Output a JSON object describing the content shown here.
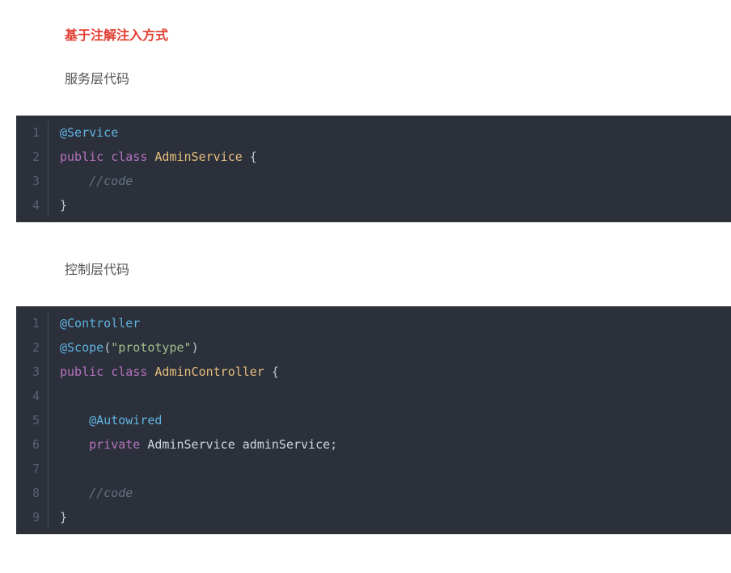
{
  "heading": "基于注解注入方式",
  "section1": {
    "title": "服务层代码",
    "lines": [
      [
        {
          "t": "@Service",
          "c": "annotation"
        }
      ],
      [
        {
          "t": "public",
          "c": "keyword"
        },
        {
          "t": " ",
          "c": "punct"
        },
        {
          "t": "class",
          "c": "keyword"
        },
        {
          "t": " ",
          "c": "punct"
        },
        {
          "t": "AdminService",
          "c": "type"
        },
        {
          "t": " {",
          "c": "punct"
        }
      ],
      [
        {
          "t": "    ",
          "c": "punct"
        },
        {
          "t": "//code",
          "c": "comment"
        }
      ],
      [
        {
          "t": "}",
          "c": "punct"
        }
      ]
    ]
  },
  "section2": {
    "title": "控制层代码",
    "lines": [
      [
        {
          "t": "@Controller",
          "c": "annotation"
        }
      ],
      [
        {
          "t": "@Scope",
          "c": "annotation"
        },
        {
          "t": "(",
          "c": "punct"
        },
        {
          "t": "\"prototype\"",
          "c": "string"
        },
        {
          "t": ")",
          "c": "punct"
        }
      ],
      [
        {
          "t": "public",
          "c": "keyword"
        },
        {
          "t": " ",
          "c": "punct"
        },
        {
          "t": "class",
          "c": "keyword"
        },
        {
          "t": " ",
          "c": "punct"
        },
        {
          "t": "AdminController",
          "c": "type"
        },
        {
          "t": " {",
          "c": "punct"
        }
      ],
      [],
      [
        {
          "t": "    ",
          "c": "punct"
        },
        {
          "t": "@Autowired",
          "c": "annotation"
        }
      ],
      [
        {
          "t": "    ",
          "c": "punct"
        },
        {
          "t": "private",
          "c": "keyword"
        },
        {
          "t": " ",
          "c": "punct"
        },
        {
          "t": "AdminService",
          "c": "ident"
        },
        {
          "t": " ",
          "c": "punct"
        },
        {
          "t": "adminService",
          "c": "ident"
        },
        {
          "t": ";",
          "c": "punct"
        }
      ],
      [],
      [
        {
          "t": "    ",
          "c": "punct"
        },
        {
          "t": "//code",
          "c": "comment"
        }
      ],
      [
        {
          "t": "}",
          "c": "punct"
        }
      ]
    ]
  }
}
